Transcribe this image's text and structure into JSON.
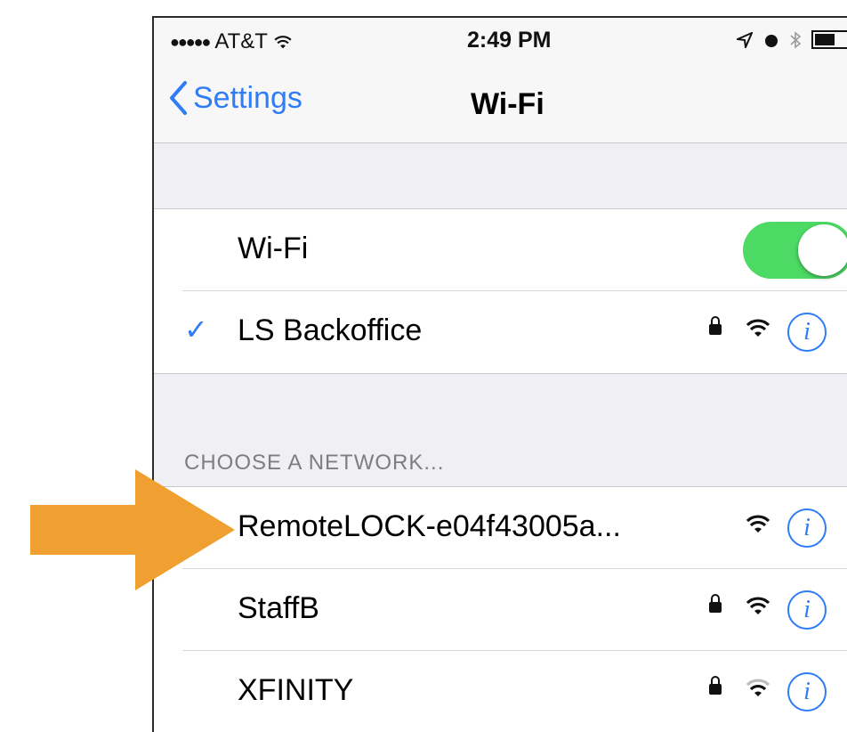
{
  "status_bar": {
    "signal_dots": "●●●●●",
    "carrier": "AT&T",
    "time": "2:49 PM"
  },
  "nav": {
    "back_label": "Settings",
    "title": "Wi-Fi"
  },
  "wifi_toggle": {
    "label": "Wi-Fi",
    "on": true
  },
  "connected": {
    "name": "LS Backoffice",
    "secured": true
  },
  "networks_header": "CHOOSE A NETWORK...",
  "networks": [
    {
      "name": "RemoteLOCK-e04f43005a...",
      "secured": false
    },
    {
      "name": "StaffB",
      "secured": true
    },
    {
      "name": "XFINITY",
      "secured": true
    }
  ],
  "colors": {
    "accent": "#2e7cf6",
    "toggle_on": "#4cd964",
    "arrow": "#f0a030"
  },
  "icons": {
    "checkmark": "✓",
    "info": "i"
  }
}
